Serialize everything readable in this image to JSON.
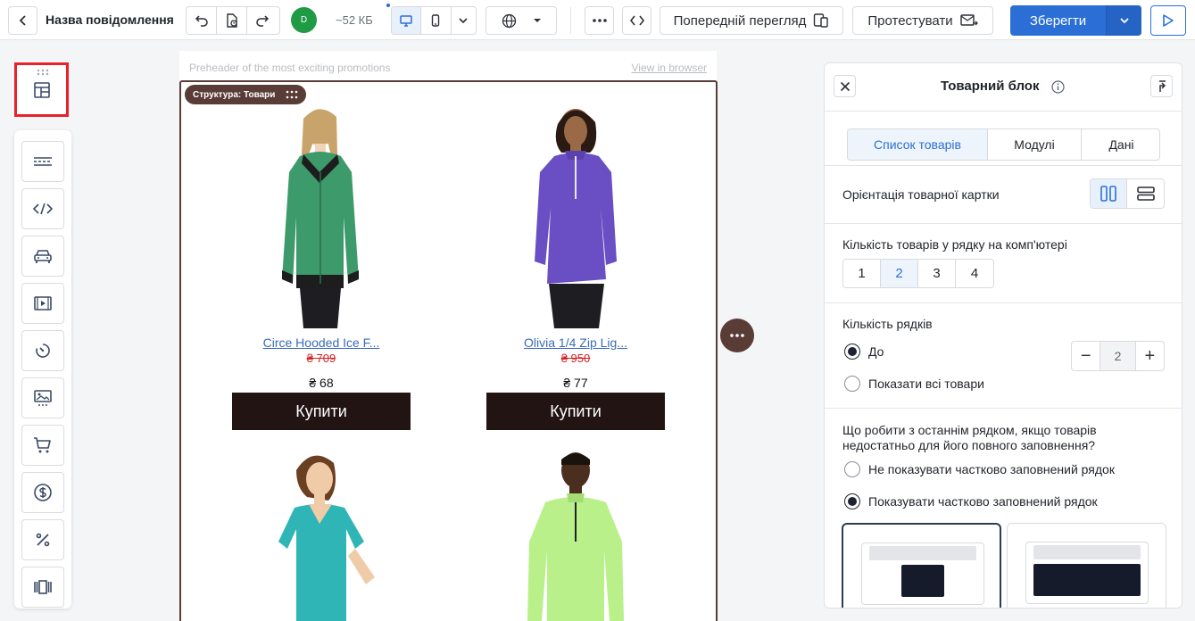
{
  "toolbar": {
    "message_title": "Назва повідомлення",
    "avatar_initial": "D",
    "size": "~52 КБ",
    "preview_label": "Попередній перегляд",
    "test_label": "Протестувати",
    "save_label": "Зберегти"
  },
  "canvas": {
    "preheader": "Preheader of the most exciting promotions",
    "view_in_browser": "View in browser",
    "structure_badge": "Структура: Товари",
    "products": [
      {
        "name": "Circe Hooded Ice F...",
        "old_price": "₴ 709",
        "price": "₴ 68",
        "buy": "Купити",
        "shirt_color": "#3d9a6a"
      },
      {
        "name": "Olivia 1/4 Zip Lig...",
        "old_price": "₴ 950",
        "price": "₴ 77",
        "buy": "Купити",
        "shirt_color": "#6a4fc4"
      },
      {
        "shirt_color": "#2fb5b5"
      },
      {
        "shirt_color": "#b9f08a"
      }
    ]
  },
  "panel": {
    "title": "Товарний блок",
    "tabs": [
      "Список товарів",
      "Модулі",
      "Дані"
    ],
    "orientation_label": "Орієнтація товарної картки",
    "per_row_label": "Кількість товарів у рядку на комп'ютері",
    "per_row_options": [
      "1",
      "2",
      "3",
      "4"
    ],
    "per_row_selected": "2",
    "rows_label": "Кількість рядків",
    "rows_option_upto": "До",
    "rows_option_all": "Показати всі товари",
    "rows_value": "2",
    "last_row_question": "Що робити з останнім рядком, якщо товарів недостатньо для його повного заповнення?",
    "last_row_hide": "Не показувати частково заповнений рядок",
    "last_row_show": "Показувати частково заповнений рядок"
  },
  "colors": {
    "accent": "#2b6fd6",
    "structure": "#5a3c37",
    "buy_button": "#231414",
    "old_price": "#d21f1f",
    "highlight_border": "#e8212b"
  },
  "icons": {
    "rail": [
      "layout-icon",
      "divider-icon",
      "code-icon",
      "car-icon",
      "video-icon",
      "timer-icon",
      "banner-icon",
      "cart-icon",
      "dollar-icon",
      "percent-icon",
      "carousel-icon"
    ]
  }
}
